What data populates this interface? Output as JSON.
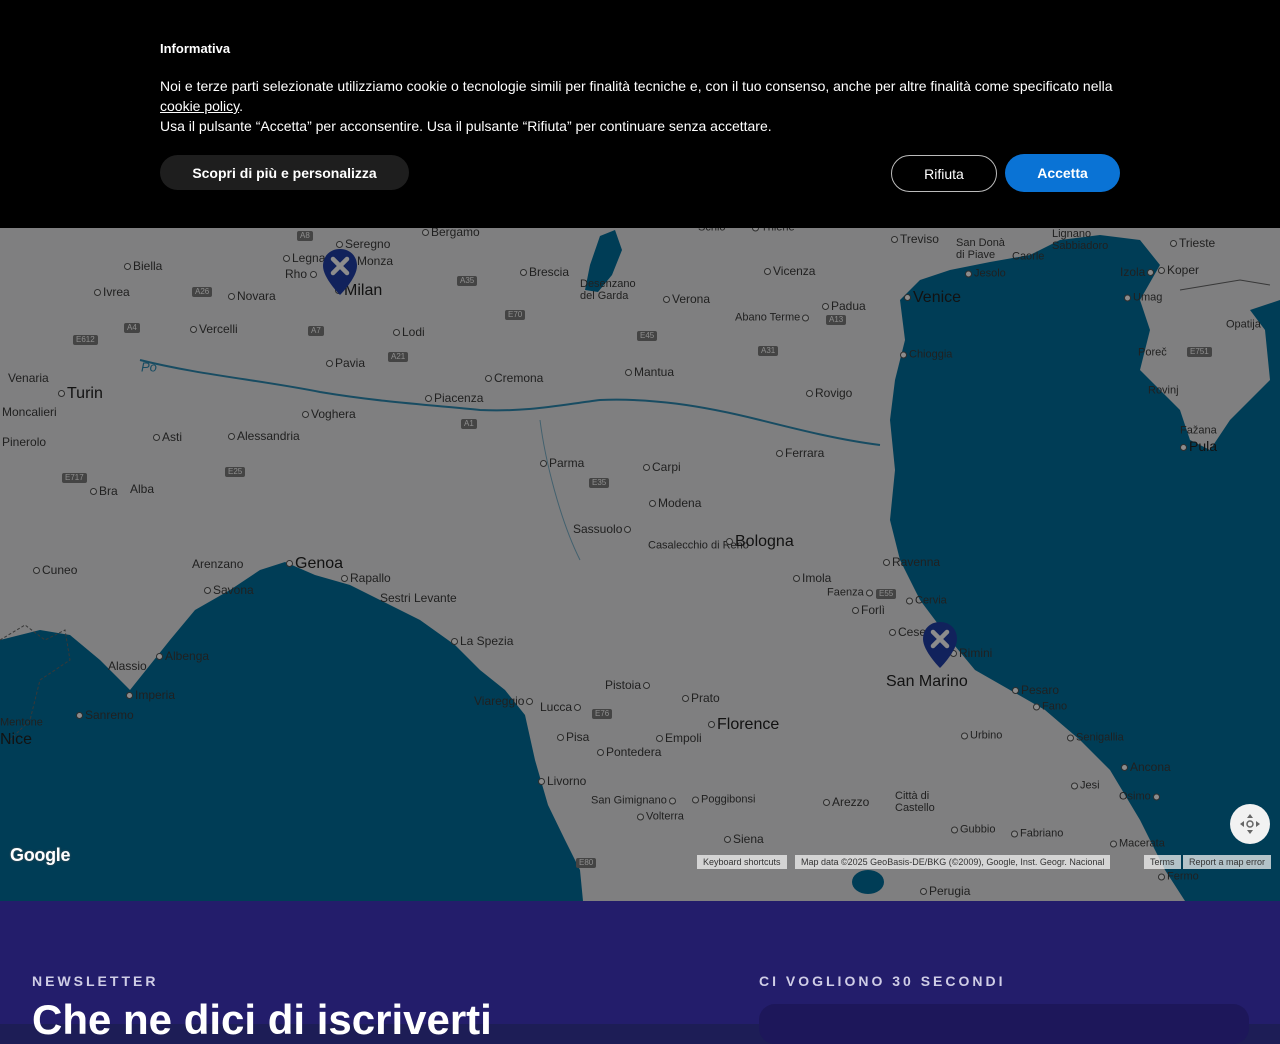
{
  "cookie_banner": {
    "title": "Informativa",
    "text_before_link": "Noi e terze parti selezionate utilizziamo cookie o tecnologie simili per finalità tecniche e, con il tuo consenso, anche per altre finalità come specificato nella ",
    "link_text": "cookie policy",
    "text_after_link": ".",
    "second_line": "Usa il pulsante “Accetta” per acconsentire. Usa il pulsante “Rifiuta” per continuare senza accettare.",
    "more_button": "Scopri di più e personalizza",
    "reject_button": "Rifiuta",
    "accept_button": "Accetta",
    "accent_color": "#0a73d5"
  },
  "map": {
    "cities": [
      "Bergamo",
      "Seregno",
      "Monza",
      "Legnano",
      "Rho",
      "Milan",
      "Brescia",
      "Biella",
      "Ivrea",
      "Novara",
      "Vercelli",
      "Lodi",
      "Pavia",
      "Cremona",
      "Venaria",
      "Turin",
      "Moncalieri",
      "Pinerolo",
      "Asti",
      "Alessandria",
      "Voghera",
      "Piacenza",
      "Bra",
      "Alba",
      "Parma",
      "Carpi",
      "Mantua",
      "Modena",
      "Sassuolo",
      "Casalecchio di Reno",
      "Bologna",
      "Cuneo",
      "Arenzano",
      "Savona",
      "Genoa",
      "Rapallo",
      "Sestri Levante",
      "La Spezia",
      "Alassio",
      "Albenga",
      "Imperia",
      "Sanremo",
      "Viareggio",
      "Lucca",
      "Pistoia",
      "Prato",
      "Florence",
      "Pisa",
      "Empoli",
      "Pontedera",
      "Livorno",
      "San Gimignano",
      "Poggibonsi",
      "Volterra",
      "Siena",
      "Desenzano del Garda",
      "Verona",
      "Vicenza",
      "Padua",
      "Abano Terme",
      "Rovigo",
      "Ferrara",
      "Chioggia",
      "Venice",
      "Treviso",
      "San Donà di Piave",
      "Jesolo",
      "Caorle",
      "Lignano Sabbiadoro",
      "Trieste",
      "Izola",
      "Koper",
      "Umag",
      "Poreč",
      "Rovinj",
      "Opatija",
      "Pula",
      "Fažana",
      "Ravenna",
      "Imola",
      "Faenza",
      "Forlì",
      "Cesena",
      "Cervia",
      "Rimini",
      "San Marino",
      "Pesaro",
      "Fano",
      "Urbino",
      "Senigallia",
      "Ancona",
      "Jesi",
      "Osimo",
      "Macerata",
      "Fermo",
      "Arezzo",
      "Città di Castello",
      "Gubbio",
      "Fabriano",
      "Perugia",
      "Po",
      "Nice",
      "Mentone",
      "Thiene",
      "Schio"
    ],
    "roads": [
      "A8",
      "A26",
      "A4",
      "A7",
      "A35",
      "A21",
      "A1",
      "A13",
      "E70",
      "E45",
      "E55",
      "E35",
      "E717",
      "E25",
      "E612",
      "A31",
      "E751",
      "E76",
      "E80"
    ],
    "pins": [
      "Milan location",
      "Rimini location"
    ],
    "google_logo": "Google",
    "keyboard_shortcuts": "Keyboard shortcuts",
    "map_data": "Map data ©2025 GeoBasis-DE/BKG (©2009), Google, Inst. Geogr. Nacional",
    "terms": "Terms",
    "report": "Report a map error",
    "pin_color": "#1f3fa8",
    "sea_color": "#00709d"
  },
  "footer": {
    "newsletter_label": "NEWSLETTER",
    "newsletter_heading": "Che ne dici di iscriverti",
    "seconds_label": "CI VOGLIONO 30 SECONDI"
  }
}
